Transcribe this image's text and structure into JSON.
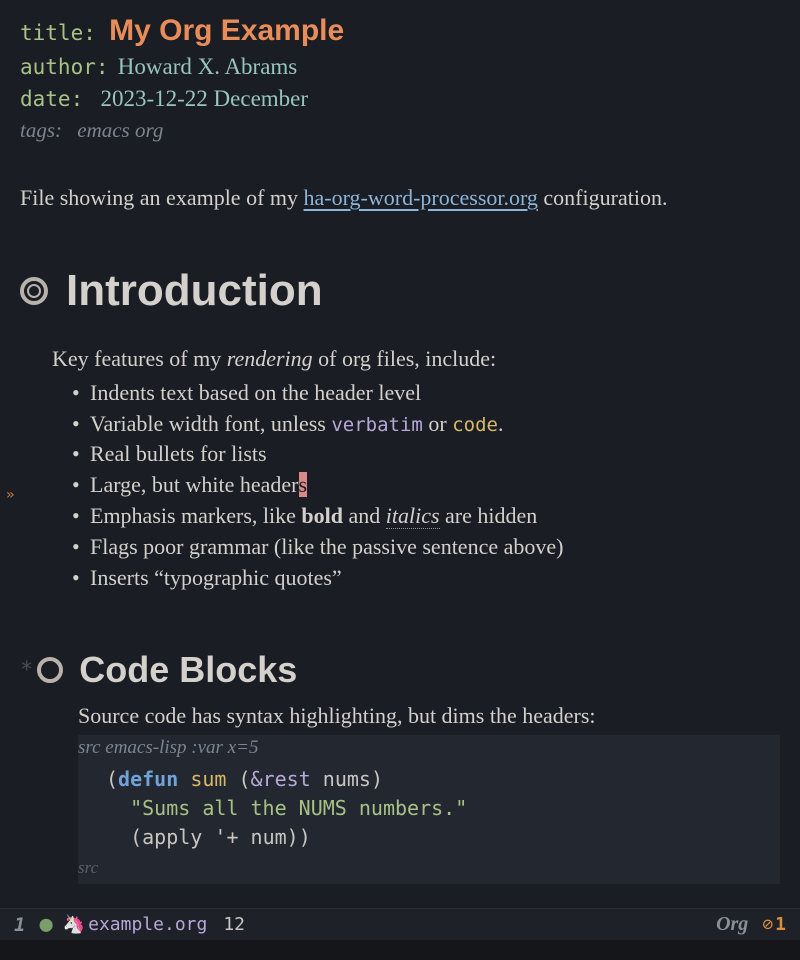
{
  "meta": {
    "title_key": "title",
    "title_value": "My Org Example",
    "author_key": "author",
    "author_value": "Howard X. Abrams",
    "date_key": "date",
    "date_value": "2023-12-22 December",
    "tags_key": "tags:",
    "tags_value": "emacs org"
  },
  "intro": {
    "before_link": "File showing an example of my ",
    "link_text": "ha-org-word-processor.org",
    "after_link": " configuration."
  },
  "headings": {
    "h1": "Introduction",
    "h2": "Code Blocks",
    "star": "*"
  },
  "section1": {
    "para_before": "Key features of my ",
    "para_italic": "rendering",
    "para_after": " of org files, include:",
    "bullets": {
      "b1": "Indents text based on the header level",
      "b2_a": "Variable width font, unless ",
      "b2_verbatim": "verbatim",
      "b2_b": " or ",
      "b2_code": "code",
      "b2_c": ".",
      "b3": "Real bullets for lists",
      "b4_a": "Large, but white header",
      "b4_cursor": "s",
      "b5_a": "Emphasis markers, like ",
      "b5_bold": "bold",
      "b5_b": " and ",
      "b5_italic": "italics",
      "b5_c": " are hidden",
      "b6": "Flags poor grammar (like the passive sentence above)",
      "b7": "Inserts “typographic quotes”"
    }
  },
  "section2": {
    "para": "Source code has syntax highlighting, but dims the headers:",
    "src_label": "src",
    "src_lang": " emacs-lisp :var x=5",
    "code": {
      "l1_paren1": "(",
      "l1_defun": "defun",
      "l1_sp1": " ",
      "l1_name": "sum",
      "l1_sp2": " ",
      "l1_paren2": "(",
      "l1_amp": "&rest",
      "l1_sp3": " ",
      "l1_nums": "nums",
      "l1_paren3": ")",
      "l2_indent": "  ",
      "l2_str": "\"Sums all the NUMS numbers.\"",
      "l3_indent": "  ",
      "l3_paren1": "(",
      "l3_apply": "apply",
      "l3_sp1": " ",
      "l3_quote": "'+",
      "l3_sp2": " ",
      "l3_num": "num",
      "l3_paren2": "))"
    },
    "src_end": "src"
  },
  "modeline": {
    "winnum": "1",
    "filename": "example.org",
    "linenum": "12",
    "mode": "Org",
    "err_count": "1"
  },
  "fringe_arrow": "»"
}
